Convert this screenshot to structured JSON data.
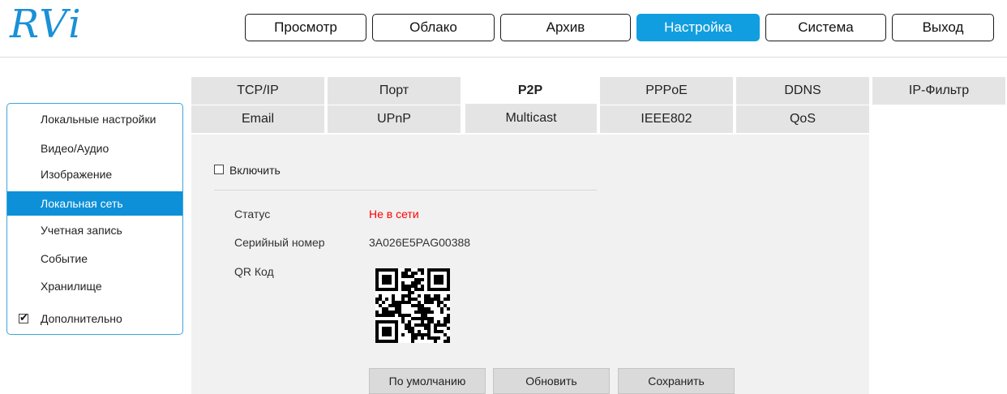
{
  "logo": {
    "text": "RVi"
  },
  "topnav": {
    "items": [
      {
        "label": "Просмотр"
      },
      {
        "label": "Облако"
      },
      {
        "label": "Архив"
      },
      {
        "label": "Настройка"
      },
      {
        "label": "Система"
      },
      {
        "label": "Выход"
      }
    ],
    "active_color": "#119ee0"
  },
  "sidebar": {
    "items": [
      {
        "label": "Локальные настройки"
      },
      {
        "label": "Видео/Аудио"
      },
      {
        "label": "Изображение"
      },
      {
        "label": "Локальная сеть"
      },
      {
        "label": "Учетная запись"
      },
      {
        "label": "Событие"
      },
      {
        "label": "Хранилище"
      }
    ],
    "advanced": {
      "label": "Дополнительно",
      "checked": true
    },
    "active_color": "#0d90d8"
  },
  "tabs": {
    "row1": [
      {
        "label": "TCP/IP"
      },
      {
        "label": "Порт"
      },
      {
        "label": "P2P"
      },
      {
        "label": "PPPoE"
      },
      {
        "label": "DDNS"
      },
      {
        "label": "IP-Фильтр"
      }
    ],
    "row2": [
      {
        "label": "Email"
      },
      {
        "label": "UPnP"
      },
      {
        "label": "Multicast"
      },
      {
        "label": "IEEE802"
      },
      {
        "label": "QoS"
      }
    ]
  },
  "p2p": {
    "enable": {
      "label": "Включить",
      "checked": false
    },
    "status": {
      "label": "Статус",
      "value": "Не в сети",
      "color": "#ff0000"
    },
    "serial": {
      "label": "Серийный номер",
      "value": "3A026E5PAG00388"
    },
    "qr": {
      "label": "QR Код",
      "icon": "qr-code-icon"
    }
  },
  "buttons": {
    "default_label": "По умолчанию",
    "refresh_label": "Обновить",
    "save_label": "Сохранить"
  }
}
